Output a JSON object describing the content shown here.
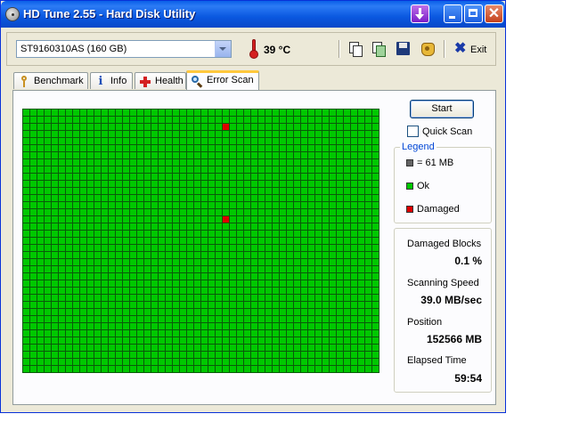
{
  "window": {
    "title": "HD Tune 2.55 - Hard Disk Utility"
  },
  "toolbar": {
    "drive": "ST9160310AS (160 GB)",
    "temperature": "39 °C",
    "exit_label": "Exit",
    "icons": [
      "copy-icon",
      "copy-results-icon",
      "save-icon",
      "options-icon",
      "exit-icon"
    ]
  },
  "tabs": [
    {
      "label": "Benchmark",
      "icon": "benchmark-icon",
      "active": false
    },
    {
      "label": "Info",
      "icon": "info-icon",
      "active": false
    },
    {
      "label": "Health",
      "icon": "health-icon",
      "active": false
    },
    {
      "label": "Error Scan",
      "icon": "search-icon",
      "active": true
    }
  ],
  "scan": {
    "start_label": "Start",
    "quick_scan_label": "Quick Scan",
    "quick_scan_checked": false,
    "grid_columns": 50,
    "grid_rows": 37,
    "damaged_blocks": [
      [
        28,
        2
      ],
      [
        28,
        15
      ]
    ],
    "colors": {
      "ok": "#00c800",
      "damaged": "#e00000",
      "block_unit": "#646464"
    }
  },
  "legend": {
    "title": "Legend",
    "items": [
      {
        "label": "= 61 MB",
        "color": "#646464"
      },
      {
        "label": "Ok",
        "color": "#00c800"
      },
      {
        "label": "Damaged",
        "color": "#e00000"
      }
    ]
  },
  "stats": {
    "damaged_blocks_label": "Damaged Blocks",
    "damaged_blocks_value": "0.1 %",
    "scanning_speed_label": "Scanning Speed",
    "scanning_speed_value": "39.0 MB/sec",
    "position_label": "Position",
    "position_value": "152566 MB",
    "elapsed_time_label": "Elapsed Time",
    "elapsed_time_value": "59:54"
  }
}
